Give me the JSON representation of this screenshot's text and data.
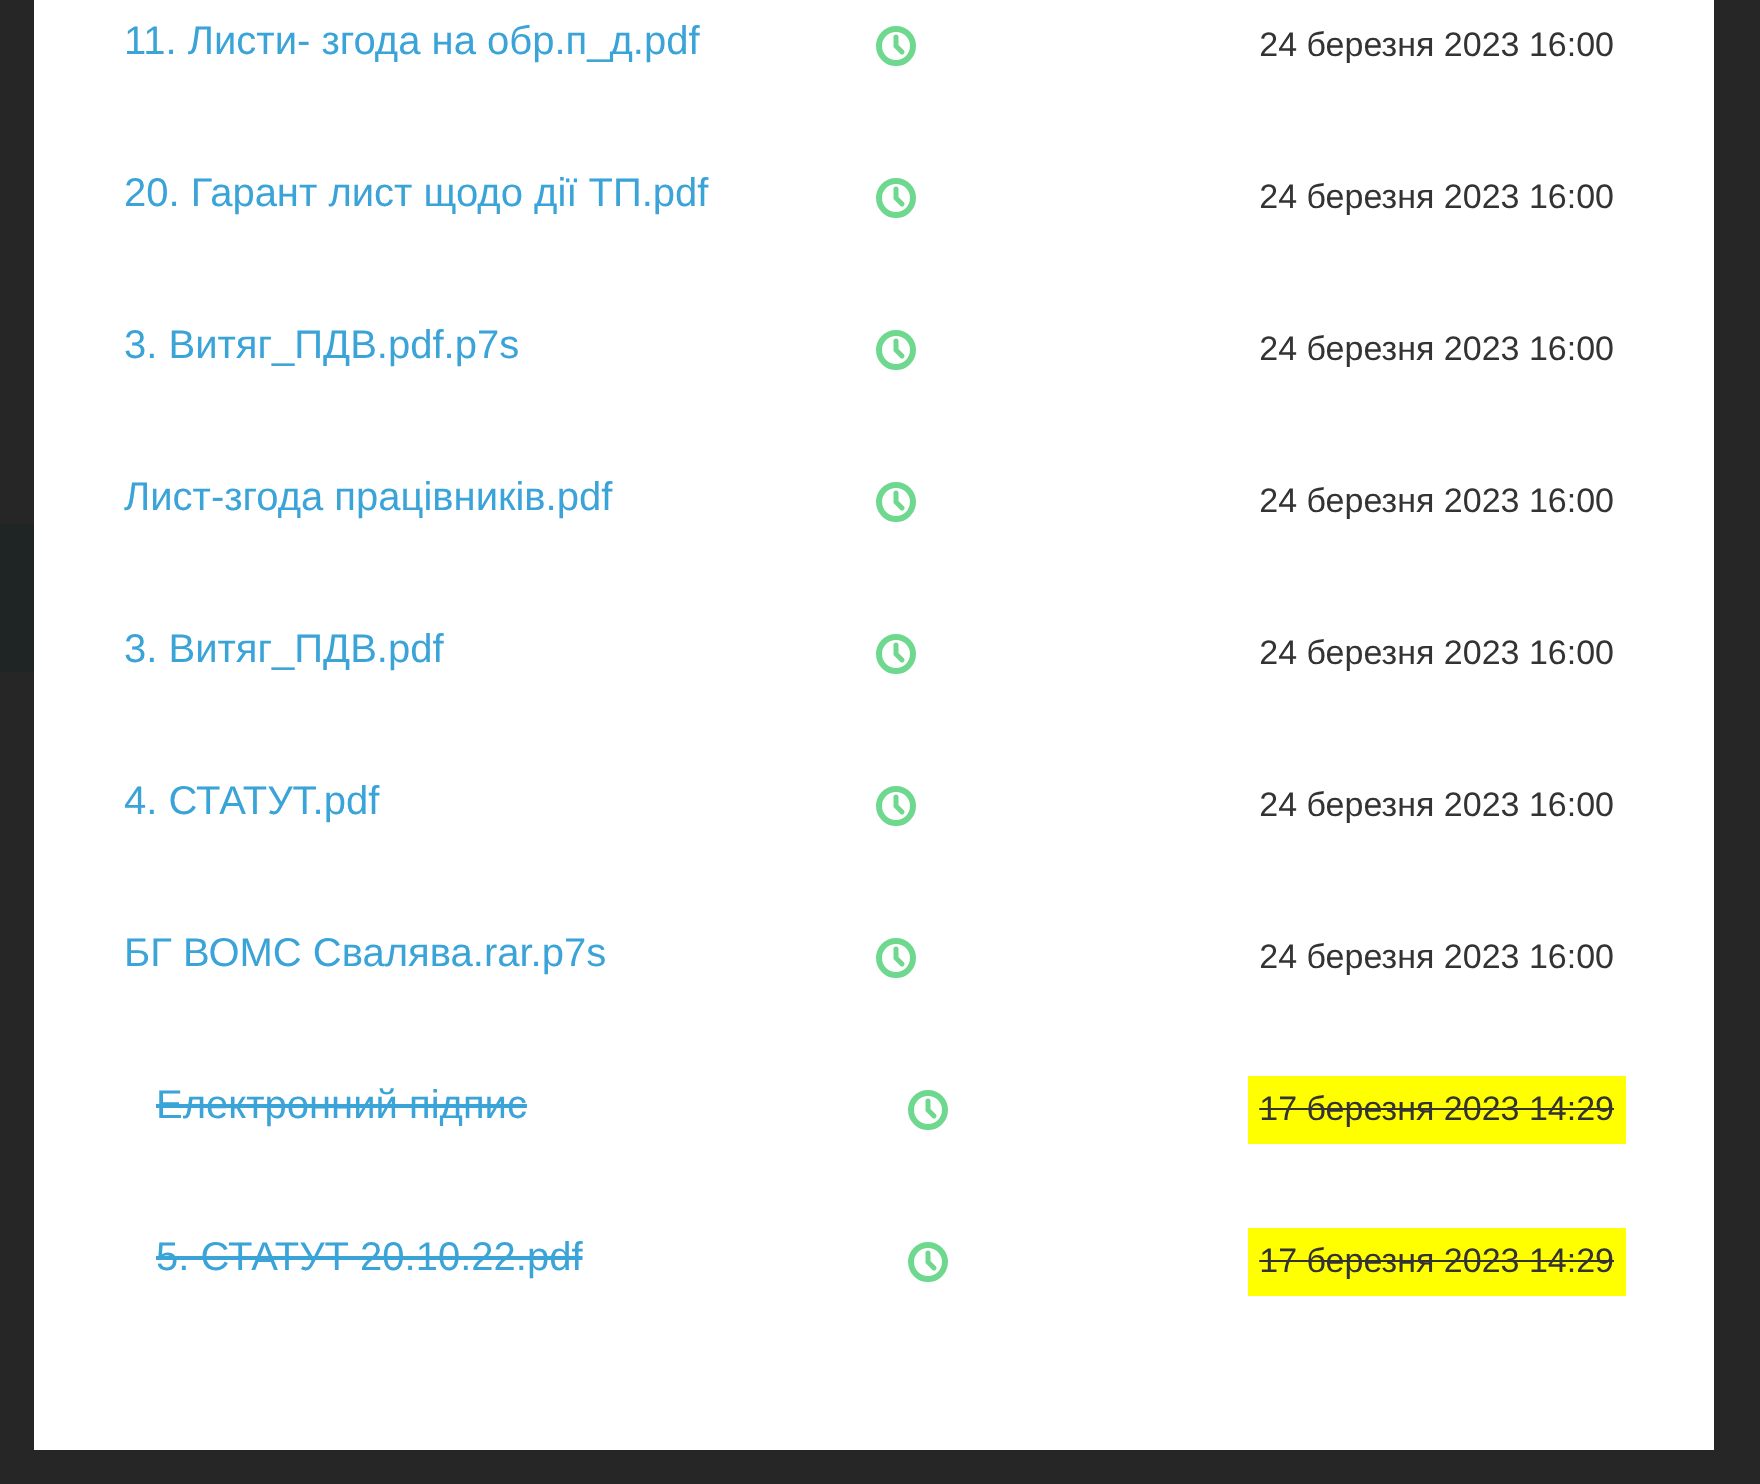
{
  "background_fragments": [
    {
      "kind": "bar"
    }
  ],
  "files": [
    {
      "name": "11. Листи- згода на обр.п_д.pdf",
      "date": "24 березня 2023 16:00",
      "revoked": false,
      "highlighted": false
    },
    {
      "name": "20. Гарант лист щодо дії ТП.pdf",
      "date": "24 березня 2023 16:00",
      "revoked": false,
      "highlighted": false
    },
    {
      "name": "3. Витяг_ПДВ.pdf.p7s",
      "date": "24 березня 2023 16:00",
      "revoked": false,
      "highlighted": false
    },
    {
      "name": "Лист-згода працівників.pdf",
      "date": "24 березня 2023 16:00",
      "revoked": false,
      "highlighted": false
    },
    {
      "name": "3. Витяг_ПДВ.pdf",
      "date": "24 березня 2023 16:00",
      "revoked": false,
      "highlighted": false
    },
    {
      "name": "4. СТАТУТ.pdf",
      "date": "24 березня 2023 16:00",
      "revoked": false,
      "highlighted": false
    },
    {
      "name": "БГ ВОМС Свалява.rar.p7s",
      "date": "24 березня 2023 16:00",
      "revoked": false,
      "highlighted": false
    },
    {
      "name": "Електронний підпис",
      "date": "17 березня 2023 14:29",
      "revoked": true,
      "highlighted": true
    },
    {
      "name": "5. СТАТУТ 20.10.22.pdf",
      "date": "17 березня 2023 14:29",
      "revoked": true,
      "highlighted": true
    }
  ]
}
